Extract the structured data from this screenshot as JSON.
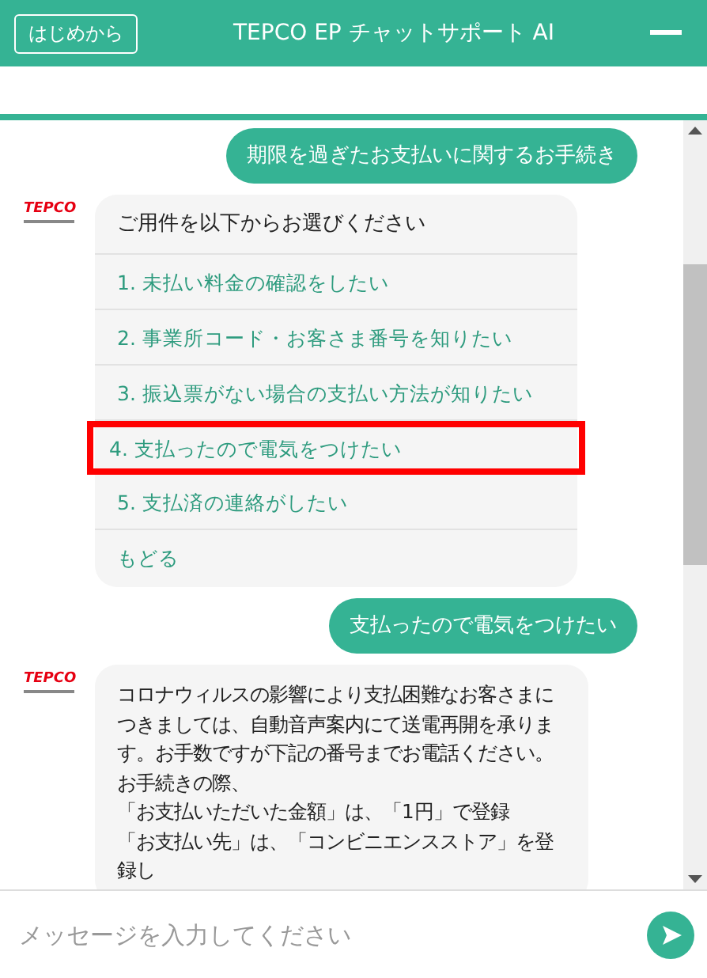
{
  "header": {
    "restart_button": "はじめから",
    "title": "TEPCO EP チャットサポート AI"
  },
  "messages": [
    {
      "kind": "user",
      "text": "期限を過ぎたお支払いに関するお手続き"
    },
    {
      "kind": "menu",
      "logo": "TEPCO",
      "prompt": "ご用件を以下からお選びください",
      "options": [
        {
          "label": "1. 未払い料金の確認をしたい",
          "highlighted": false
        },
        {
          "label": "2. 事業所コード・お客さま番号を知りたい",
          "highlighted": false
        },
        {
          "label": "3. 振込票がない場合の支払い方法が知りたい",
          "highlighted": false
        },
        {
          "label": "4. 支払ったので電気をつけたい",
          "highlighted": true
        },
        {
          "label": "5. 支払済の連絡がしたい",
          "highlighted": false
        },
        {
          "label": "もどる",
          "highlighted": false
        }
      ]
    },
    {
      "kind": "user",
      "text": "支払ったので電気をつけたい"
    },
    {
      "kind": "bot",
      "logo": "TEPCO",
      "paragraphs": [
        "コロナウィルスの影響により支払困難なお客さまにつきましては、自動音声案内にて送電再開を承ります。お手数ですが下記の番号までお電話ください。",
        "お手続きの際、",
        "「お支払いただいた金額」は、「1円」で登録",
        "「お支払い先」は、「コンビニエンスストア」を登録し"
      ]
    }
  ],
  "input": {
    "placeholder": "メッセージを入力してください"
  }
}
